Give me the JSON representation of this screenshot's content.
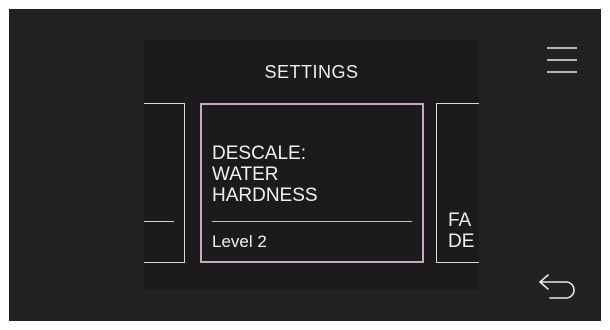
{
  "header": {
    "title": "SETTINGS"
  },
  "carousel": {
    "left_card": {
      "label": ""
    },
    "center_card": {
      "label": "DESCALE:\nWATER\nHARDNESS",
      "value": "Level 2"
    },
    "right_card": {
      "label": "FA\nDE"
    }
  },
  "icons": {
    "menu": "hamburger-menu-icon",
    "back": "back-arrow-icon"
  },
  "colors": {
    "screen_bg": "#222222",
    "panel_bg": "#1b1b1b",
    "selected_border": "#c7a7c8",
    "text": "#f0f0f0"
  }
}
